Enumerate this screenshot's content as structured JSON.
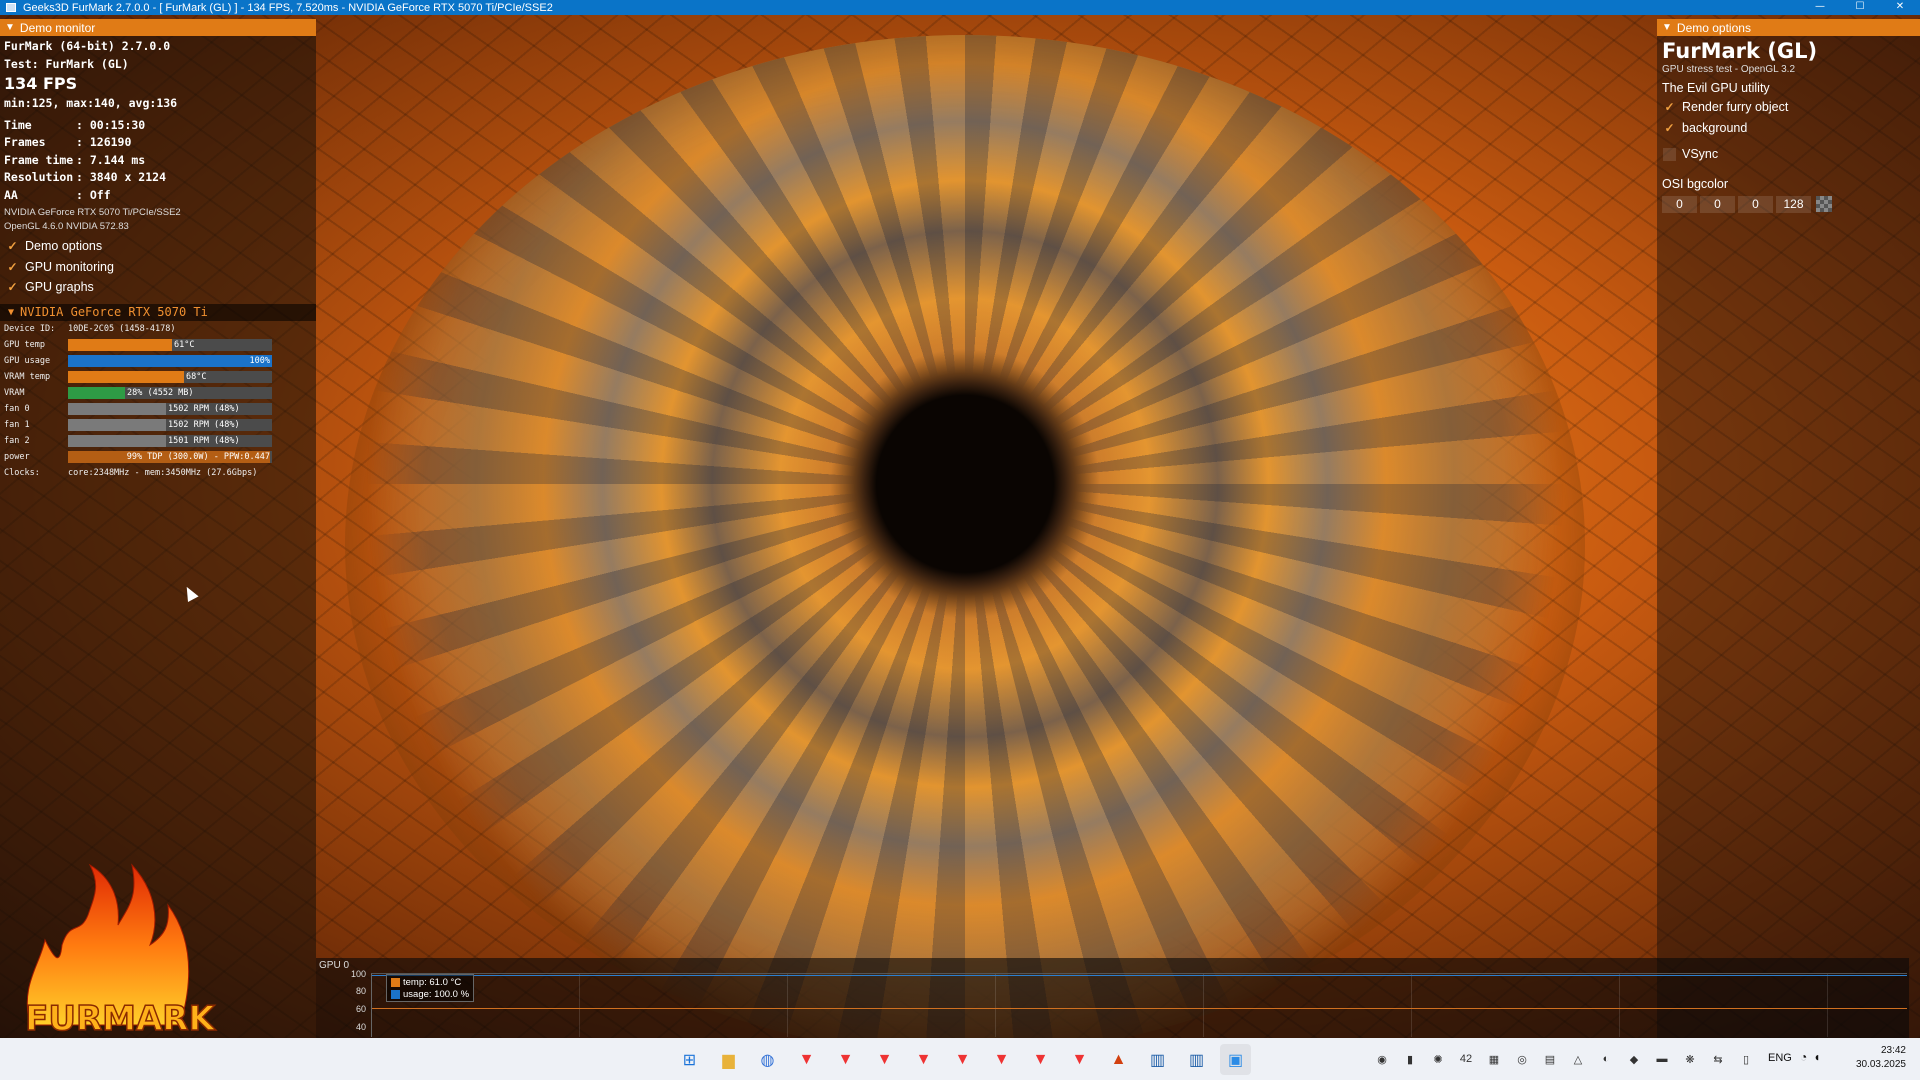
{
  "window": {
    "title": "Geeks3D FurMark 2.7.0.0 - [ FurMark (GL) ] - 134 FPS, 7.520ms - NVIDIA GeForce RTX 5070 Ti/PCIe/SSE2",
    "controls": [
      "—",
      "☐",
      "✕"
    ]
  },
  "monitor": {
    "header": "Demo monitor",
    "app_version": "FurMark (64-bit) 2.7.0.0",
    "test": "Test: FurMark (GL)",
    "fps": "134 FPS",
    "fps_stats": "min:125, max:140, avg:136",
    "rows": [
      {
        "label": "Time",
        "value": ": 00:15:30"
      },
      {
        "label": "Frames",
        "value": ": 126190"
      },
      {
        "label": "Frame time",
        "value": ": 7.144 ms"
      },
      {
        "label": "Resolution",
        "value": ": 3840 x 2124"
      },
      {
        "label": "AA",
        "value": ": Off"
      }
    ],
    "renderer": "NVIDIA GeForce RTX 5070 Ti/PCIe/SSE2",
    "opengl": "OpenGL 4.6.0 NVIDIA 572.83",
    "checkboxes": [
      {
        "label": "Demo options",
        "checked": true
      },
      {
        "label": "GPU monitoring",
        "checked": true
      },
      {
        "label": "GPU graphs",
        "checked": true
      }
    ]
  },
  "gpu": {
    "header": "NVIDIA GeForce RTX 5070 Ti",
    "device_id_label": "Device ID:",
    "device_id": "10DE-2C05 (1458-4178)",
    "bars": [
      {
        "label": "GPU temp",
        "text": "61°C",
        "fill": 0.51,
        "color": "#e07b16"
      },
      {
        "label": "GPU usage",
        "text": "100%",
        "fill": 1.0,
        "color": "#1b73c9"
      },
      {
        "label": "VRAM temp",
        "text": "68°C",
        "fill": 0.57,
        "color": "#e07b16"
      },
      {
        "label": "VRAM",
        "text": "28% (4552 MB)",
        "fill": 0.28,
        "color": "#2e9b45"
      },
      {
        "label": "fan 0",
        "text": "1502 RPM (48%)",
        "fill": 0.48,
        "color": "#7a7a7a"
      },
      {
        "label": "fan 1",
        "text": "1502 RPM (48%)",
        "fill": 0.48,
        "color": "#7a7a7a"
      },
      {
        "label": "fan 2",
        "text": "1501 RPM (48%)",
        "fill": 0.48,
        "color": "#7a7a7a"
      },
      {
        "label": "power",
        "text": "99% TDP (300.0W) - PPW:0.447",
        "fill": 0.99,
        "color": "#b45e14"
      }
    ],
    "clocks_label": "Clocks:",
    "clocks": "core:2348MHz - mem:3450MHz (27.6Gbps)"
  },
  "logo": {
    "text": "FURMARK"
  },
  "options": {
    "header": "Demo options",
    "title": "FurMark (GL)",
    "subtitle": "GPU stress test - OpenGL 3.2",
    "tagline": "The Evil GPU utility",
    "checkboxes": [
      {
        "label": "Render furry object",
        "checked": true
      },
      {
        "label": "background",
        "checked": true
      }
    ],
    "vsync": {
      "label": "VSync",
      "checked": false
    },
    "osi_label": "OSI bgcolor",
    "osi_values": [
      "0",
      "0",
      "0",
      "128"
    ]
  },
  "graph": {
    "title": "GPU 0",
    "y_ticks": [
      "100",
      "80",
      "60",
      "40"
    ],
    "legend": [
      {
        "label": "temp: 61.0 °C",
        "color": "#e07b16"
      },
      {
        "label": "usage: 100.0 %",
        "color": "#1b73c9"
      }
    ]
  },
  "taskbar": {
    "pinned": [
      {
        "name": "start-icon",
        "glyph": "⊞",
        "color": "#1a73d9"
      },
      {
        "name": "file-explorer-icon",
        "glyph": "▆",
        "color": "#e8b23a"
      },
      {
        "name": "copilot-icon",
        "glyph": "◍",
        "color": "#2f6fd6"
      },
      {
        "name": "vivaldi-icon-1",
        "glyph": "▼",
        "color": "#e33"
      },
      {
        "name": "vivaldi-icon-2",
        "glyph": "▼",
        "color": "#e33"
      },
      {
        "name": "vivaldi-icon-3",
        "glyph": "▼",
        "color": "#e33"
      },
      {
        "name": "vivaldi-icon-4",
        "glyph": "▼",
        "color": "#e33"
      },
      {
        "name": "vivaldi-icon-5",
        "glyph": "▼",
        "color": "#e33"
      },
      {
        "name": "vivaldi-icon-6",
        "glyph": "▼",
        "color": "#e33"
      },
      {
        "name": "vivaldi-icon-7",
        "glyph": "▼",
        "color": "#e33"
      },
      {
        "name": "vivaldi-icon-8",
        "glyph": "▼",
        "color": "#e33"
      },
      {
        "name": "furmark-icon",
        "glyph": "▲",
        "color": "#d2400f"
      },
      {
        "name": "monitor-app-icon-1",
        "glyph": "▥",
        "color": "#1d5ea8"
      },
      {
        "name": "monitor-app-icon-2",
        "glyph": "▥",
        "color": "#1d5ea8"
      },
      {
        "name": "window-app-icon",
        "glyph": "▣",
        "color": "#2b8be6"
      }
    ],
    "tray": [
      "◉",
      "▮",
      "✺",
      "42",
      "▦",
      "◎",
      "▤",
      "△",
      "◐",
      "◆",
      "▬",
      "❋",
      "⇆",
      "▯"
    ],
    "lang": "ENG",
    "sys": [
      "◔",
      "◖"
    ],
    "time": "23:42",
    "date": "30.03.2025"
  }
}
